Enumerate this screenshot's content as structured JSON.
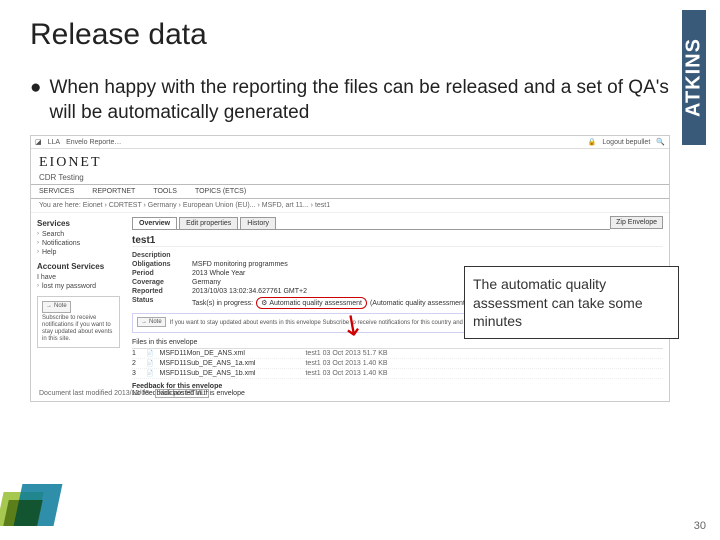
{
  "slide": {
    "title": "Release data",
    "bullet": "When happy with the reporting the files can be released and a set of QA's will be automatically generated",
    "page_number": "30",
    "callout": "The automatic quality assessment can take some minutes"
  },
  "logo": {
    "text": "ATKINS"
  },
  "browser": {
    "lla": "LLA",
    "label": "Envelo Reporte…",
    "logout": "Logout bepullet"
  },
  "eionet": {
    "title": "EIONET",
    "sub": "CDR Testing"
  },
  "nav": {
    "services": "SERVICES",
    "reportnet": "REPORTNET",
    "tools": "TOOLS",
    "topics": "TOPICS (ETCS)"
  },
  "breadcrumb": "You are here: Eionet › CDRTEST › Germany › European Union (EU)... › MSFD, art 11... › test1",
  "sidebar": {
    "services_h": "Services",
    "search": "Search",
    "notifications": "Notifications",
    "help": "Help",
    "account_h": "Account Services",
    "ihave": "I have",
    "lostpw": "lost my password",
    "note_label": "Note",
    "note_text": "Subscribe to receive notifications if you want to stay updated about events in this site."
  },
  "tabs": {
    "overview": "Overview",
    "edit": "Edit properties",
    "history": "History",
    "zip": "Zip Envelope"
  },
  "env": {
    "title": "test1",
    "desc_label": "Description",
    "obl_label": "Obligations",
    "obl_val": "MSFD monitoring programmes",
    "period_label": "Period",
    "period_val": "2013   Whole Year",
    "cov_label": "Coverage",
    "cov_val": "Germany",
    "rep_label": "Reported",
    "rep_val": "2013/10/03 13:02:34.627761 GMT+2",
    "status_label": "Status",
    "status_prefix": "Task(s) in progress:",
    "qa_text": "Automatic quality assessment",
    "qa_paren": "(Automatic quality assessment)"
  },
  "inner_note": {
    "label": "Note",
    "text": "If you want to stay updated about events in this envelope Subscribe to receive notifications for this country and the current dataflow(s)."
  },
  "files": {
    "heading": "Files in this envelope",
    "rows": [
      {
        "idx": "1",
        "name": "MSFD11Mon_DE_ANS.xml",
        "meta": "test1  03 Oct 2013  51.7 KB"
      },
      {
        "idx": "2",
        "name": "MSFD11Sub_DE_ANS_1a.xml",
        "meta": "test1  03 Oct 2013  1.40 KB"
      },
      {
        "idx": "3",
        "name": "MSFD11Sub_DE_ANS_1b.xml",
        "meta": "test1  03 Oct 2013  1.40 KB"
      }
    ],
    "feedback_h": "Feedback for this envelope",
    "feedback_t": "No feedback posted in this envelope"
  },
  "footer": {
    "modified": "Document last modified 2013/10/03",
    "validate": "Validate HTML"
  }
}
